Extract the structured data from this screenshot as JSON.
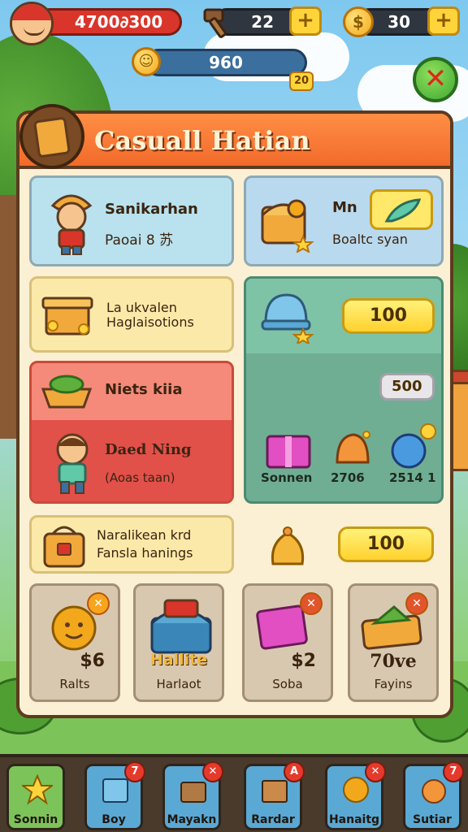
{
  "hud": {
    "player_score": "4700∂300",
    "hammers_count": "22",
    "gold_count": "30",
    "coin_meter_value": "960",
    "plus_label": "+",
    "small_badge": "20",
    "close_label": "✕"
  },
  "panel": {
    "title": "Casuall Hatian",
    "cards": {
      "character": {
        "title": "Sanikarhan",
        "subtitle": "Paoai 8 苏"
      },
      "chest": {
        "title": "Mn",
        "subtitle": "Boaltc syan"
      },
      "box": {
        "title_line1": "La ukvalen",
        "title_line2": "Haglaisotions"
      },
      "gem": {
        "button_value": "100"
      },
      "red_top": {
        "title": "Niets kiia"
      },
      "red_bottom": {
        "title": "Daed Ning",
        "subtitle": "(Aoas taan)"
      },
      "price_tag": "500",
      "mini_items": [
        {
          "label": "Sonnen"
        },
        {
          "label": "2706"
        },
        {
          "label": "2514 1"
        }
      ],
      "bag": {
        "title_line1": "Naralikean krd",
        "title_line2": "Fansla hanings"
      },
      "bag_button_value": "100"
    },
    "tiles": [
      {
        "price": "$6",
        "label": "Ralts"
      },
      {
        "price": "Hallite",
        "label": "Harlaot"
      },
      {
        "price": "$2",
        "label": "Soba"
      },
      {
        "price": "70ve",
        "label": "Fayins"
      }
    ],
    "tile_x": "✕"
  },
  "bottom_nav": [
    {
      "label": "Sonnin",
      "badge": ""
    },
    {
      "label": "Boy",
      "badge": "7"
    },
    {
      "label": "Mayakn",
      "badge": "✕"
    },
    {
      "label": "Rardar",
      "badge": "A"
    },
    {
      "label": "Hanaitg",
      "badge": "✕"
    },
    {
      "label": "Sutiar",
      "badge": "7"
    }
  ]
}
